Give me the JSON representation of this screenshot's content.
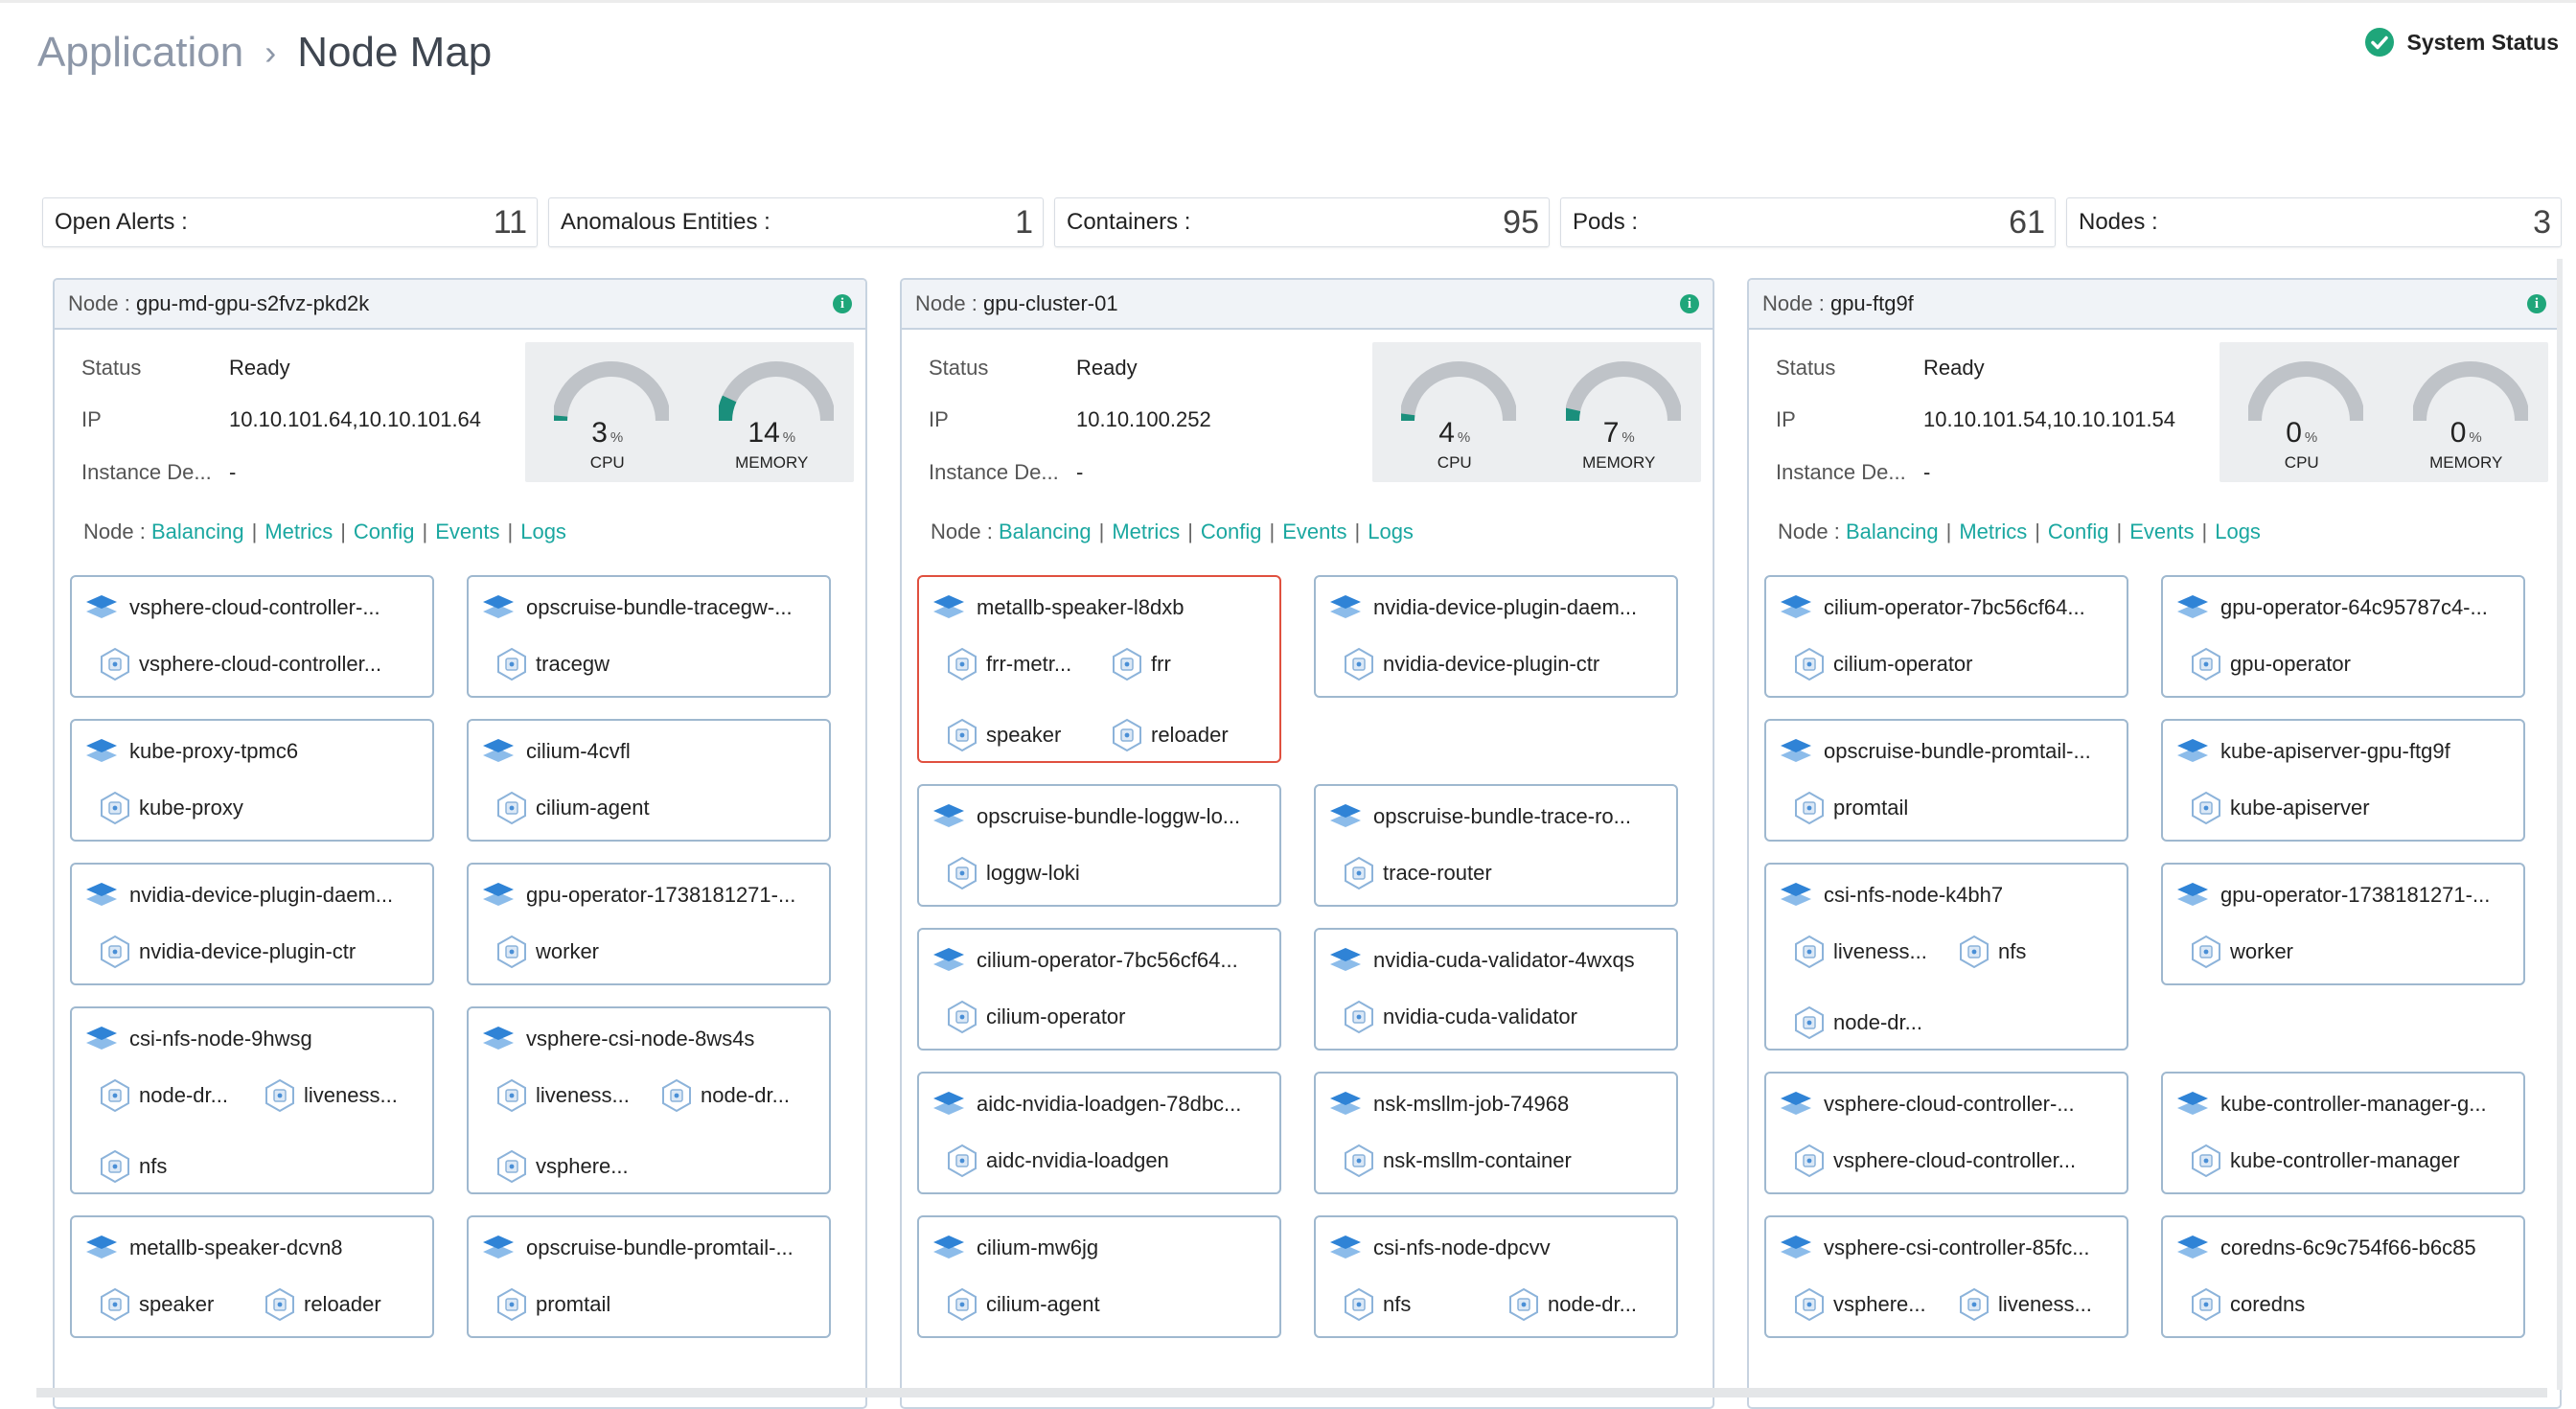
{
  "breadcrumb": {
    "parent": "Application",
    "separator": "›",
    "current": "Node Map"
  },
  "system_status": {
    "label": "System Status",
    "color": "#1fa67a"
  },
  "stats": [
    {
      "label": "Open Alerts :",
      "value": "11"
    },
    {
      "label": "Anomalous Entities :",
      "value": "1"
    },
    {
      "label": "Containers :",
      "value": "95"
    },
    {
      "label": "Pods :",
      "value": "61"
    },
    {
      "label": "Nodes :",
      "value": "3"
    }
  ],
  "colors": {
    "link": "#1aa7a0",
    "gauge_fill": "#1a8f7c",
    "card_border": "#9fb8cf",
    "alert_border": "#e0503f",
    "pod_icon": "#2f83d6"
  },
  "nodes": [
    {
      "label_prefix": "Node :",
      "name": "gpu-md-gpu-s2fvz-pkd2k",
      "status_label": "Status",
      "status": "Ready",
      "ip_label": "IP",
      "ip": "10.10.101.64,10.10.101.64",
      "instance_label": "Instance De...",
      "instance": "-",
      "cpu": {
        "value": "3",
        "unit": "%",
        "label": "CPU",
        "fraction": 0.03
      },
      "memory": {
        "value": "14",
        "unit": "%",
        "label": "MEMORY",
        "fraction": 0.14
      },
      "links_prefix": "Node :",
      "links": [
        "Balancing",
        "Metrics",
        "Config",
        "Events",
        "Logs"
      ],
      "pods": [
        {
          "name": "vsphere-cloud-controller-...",
          "containers": [
            "vsphere-cloud-controller..."
          ]
        },
        {
          "name": "opscruise-bundle-tracegw-...",
          "containers": [
            "tracegw"
          ]
        },
        {
          "name": "kube-proxy-tpmc6",
          "containers": [
            "kube-proxy"
          ]
        },
        {
          "name": "cilium-4cvfl",
          "containers": [
            "cilium-agent"
          ]
        },
        {
          "name": "nvidia-device-plugin-daem...",
          "containers": [
            "nvidia-device-plugin-ctr"
          ]
        },
        {
          "name": "gpu-operator-1738181271-...",
          "containers": [
            "worker"
          ]
        },
        {
          "name": "csi-nfs-node-9hwsg",
          "containers": [
            "node-dr...",
            "liveness...",
            "nfs"
          ]
        },
        {
          "name": "vsphere-csi-node-8ws4s",
          "containers": [
            "liveness...",
            "node-dr...",
            "vsphere..."
          ]
        },
        {
          "name": "metallb-speaker-dcvn8",
          "containers": [
            "speaker",
            "reloader"
          ]
        },
        {
          "name": "opscruise-bundle-promtail-...",
          "containers": [
            "promtail"
          ]
        }
      ]
    },
    {
      "label_prefix": "Node :",
      "name": "gpu-cluster-01",
      "status_label": "Status",
      "status": "Ready",
      "ip_label": "IP",
      "ip": "10.10.100.252",
      "instance_label": "Instance De...",
      "instance": "-",
      "cpu": {
        "value": "4",
        "unit": "%",
        "label": "CPU",
        "fraction": 0.04
      },
      "memory": {
        "value": "7",
        "unit": "%",
        "label": "MEMORY",
        "fraction": 0.07
      },
      "links_prefix": "Node :",
      "links": [
        "Balancing",
        "Metrics",
        "Config",
        "Events",
        "Logs"
      ],
      "pods": [
        {
          "name": "metallb-speaker-l8dxb",
          "containers": [
            "frr-metr...",
            "frr",
            "speaker",
            "reloader"
          ],
          "alert": true
        },
        {
          "name": "nvidia-device-plugin-daem...",
          "containers": [
            "nvidia-device-plugin-ctr"
          ]
        },
        {
          "name": "opscruise-bundle-loggw-lo...",
          "containers": [
            "loggw-loki"
          ]
        },
        {
          "name": "opscruise-bundle-trace-ro...",
          "containers": [
            "trace-router"
          ]
        },
        {
          "name": "cilium-operator-7bc56cf64...",
          "containers": [
            "cilium-operator"
          ]
        },
        {
          "name": "nvidia-cuda-validator-4wxqs",
          "containers": [
            "nvidia-cuda-validator"
          ]
        },
        {
          "name": "aidc-nvidia-loadgen-78dbc...",
          "containers": [
            "aidc-nvidia-loadgen"
          ]
        },
        {
          "name": "nsk-msllm-job-74968",
          "containers": [
            "nsk-msllm-container"
          ]
        },
        {
          "name": "cilium-mw6jg",
          "containers": [
            "cilium-agent"
          ]
        },
        {
          "name": "csi-nfs-node-dpcvv",
          "containers": [
            "nfs",
            "node-dr..."
          ]
        }
      ]
    },
    {
      "label_prefix": "Node :",
      "name": "gpu-ftg9f",
      "status_label": "Status",
      "status": "Ready",
      "ip_label": "IP",
      "ip": "10.10.101.54,10.10.101.54",
      "instance_label": "Instance De...",
      "instance": "-",
      "cpu": {
        "value": "0",
        "unit": "%",
        "label": "CPU",
        "fraction": 0
      },
      "memory": {
        "value": "0",
        "unit": "%",
        "label": "MEMORY",
        "fraction": 0
      },
      "links_prefix": "Node :",
      "links": [
        "Balancing",
        "Metrics",
        "Config",
        "Events",
        "Logs"
      ],
      "pods": [
        {
          "name": "cilium-operator-7bc56cf64...",
          "containers": [
            "cilium-operator"
          ]
        },
        {
          "name": "gpu-operator-64c95787c4-...",
          "containers": [
            "gpu-operator"
          ]
        },
        {
          "name": "opscruise-bundle-promtail-...",
          "containers": [
            "promtail"
          ]
        },
        {
          "name": "kube-apiserver-gpu-ftg9f",
          "containers": [
            "kube-apiserver"
          ]
        },
        {
          "name": "csi-nfs-node-k4bh7",
          "containers": [
            "liveness...",
            "nfs",
            "node-dr..."
          ]
        },
        {
          "name": "gpu-operator-1738181271-...",
          "containers": [
            "worker"
          ]
        },
        {
          "name": "vsphere-cloud-controller-...",
          "containers": [
            "vsphere-cloud-controller..."
          ]
        },
        {
          "name": "kube-controller-manager-g...",
          "containers": [
            "kube-controller-manager"
          ]
        },
        {
          "name": "vsphere-csi-controller-85fc...",
          "containers": [
            "vsphere...",
            "liveness..."
          ]
        },
        {
          "name": "coredns-6c9c754f66-b6c85",
          "containers": [
            "coredns"
          ]
        }
      ]
    }
  ]
}
